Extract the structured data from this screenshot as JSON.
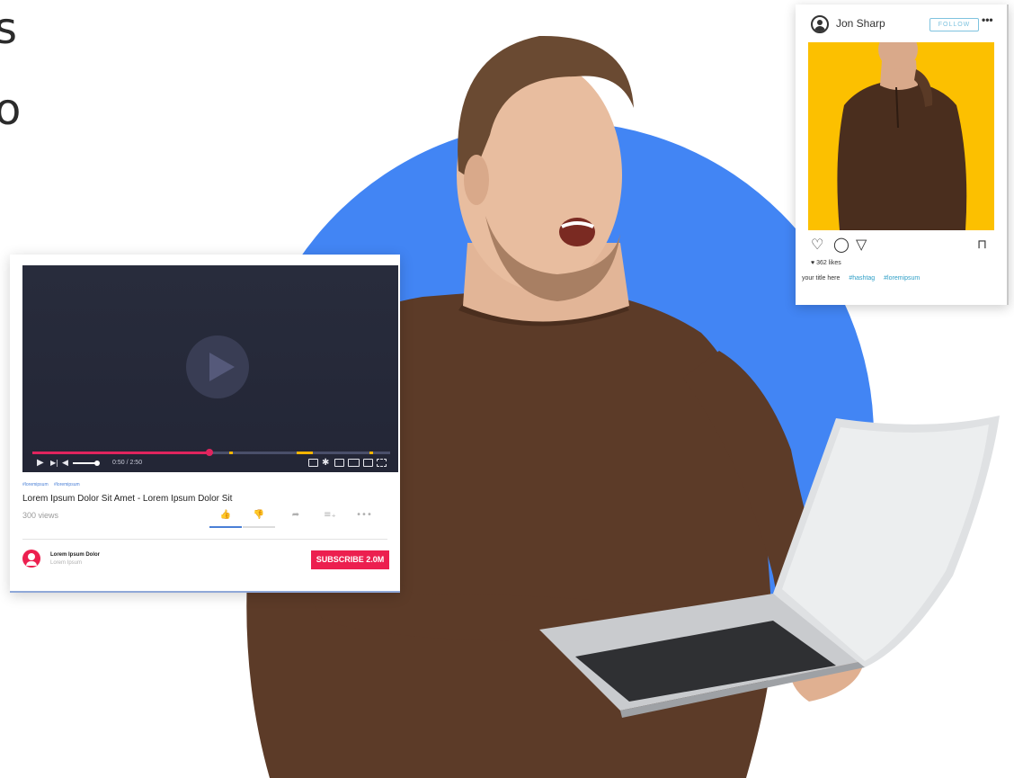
{
  "edge_text": {
    "top": "s",
    "middle": "o"
  },
  "video": {
    "time_display": "0:50 / 2:50",
    "progress_fraction": 0.5,
    "hashtags": [
      "#loremipsum",
      "#loremipsum"
    ],
    "title": "Lorem Ipsum Dolor Sit Amet - Lorem Ipsum Dolor Sit",
    "views": "300 views",
    "channel_name": "Lorem Ipsum Dolor",
    "channel_subtitle": "Lorem Ipsum",
    "subscribe_label": "SUBSCRIBE 2.0M",
    "icons": {
      "play": "play-icon",
      "next": "next-icon",
      "volume": "volume-icon",
      "more": "more-icon"
    },
    "colors": {
      "accent": "#ec1f4f",
      "like": "#4a7fd6",
      "screen": "#282c3c"
    }
  },
  "instagram": {
    "username": "Jon Sharp",
    "follow_label": "FOLLOW",
    "more_label": "•••",
    "likes": "362 likes",
    "caption_title": "your title here",
    "hashtags": [
      "#hashtag",
      "#loremipsum"
    ],
    "colors": {
      "photo_bg": "#fcc000",
      "link": "#2f9fc7",
      "follow": "#7ec3df"
    }
  },
  "scene": {
    "circle_color": "#4285f4"
  }
}
